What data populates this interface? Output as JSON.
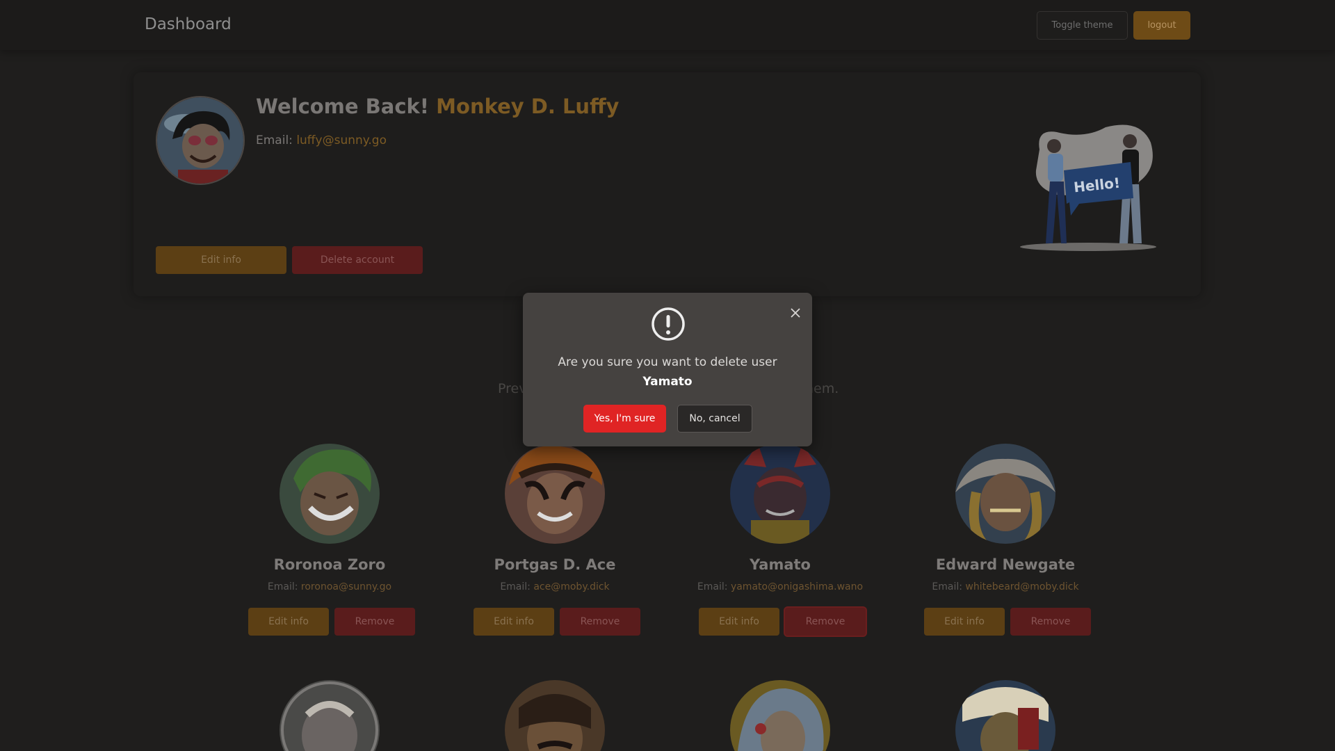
{
  "navbar": {
    "brand": "Dashboard",
    "toggle_theme_label": "Toggle theme",
    "logout_label": "logout"
  },
  "profile": {
    "welcome_prefix": "Welcome Back!",
    "name": "Monkey D. Luffy",
    "email_label": "Email:",
    "email": "luffy@sunny.go",
    "edit_label": "Edit info",
    "delete_label": "Delete account",
    "illustration_text": "Hello!"
  },
  "section": {
    "subtitle_left": "Prev",
    "subtitle_right": "hem."
  },
  "users": [
    {
      "name": "Roronoa Zoro",
      "email_label": "Email:",
      "email": "roronoa@sunny.go",
      "edit_label": "Edit info",
      "remove_label": "Remove"
    },
    {
      "name": "Portgas D. Ace",
      "email_label": "Email:",
      "email": "ace@moby.dick",
      "edit_label": "Edit info",
      "remove_label": "Remove"
    },
    {
      "name": "Yamato",
      "email_label": "Email:",
      "email": "yamato@onigashima.wano",
      "edit_label": "Edit info",
      "remove_label": "Remove"
    },
    {
      "name": "Edward Newgate",
      "email_label": "Email:",
      "email": "whitebeard@moby.dick",
      "edit_label": "Edit info",
      "remove_label": "Remove"
    }
  ],
  "modal": {
    "message": "Are you sure you want to delete user",
    "user": "Yamato",
    "confirm_label": "Yes, I'm sure",
    "cancel_label": "No, cancel",
    "icon": "exclamation-circle-icon",
    "close_icon": "close-icon"
  },
  "colors": {
    "accent": "#7d5b24",
    "danger": "#e02424",
    "background": "#1f1e1d"
  }
}
